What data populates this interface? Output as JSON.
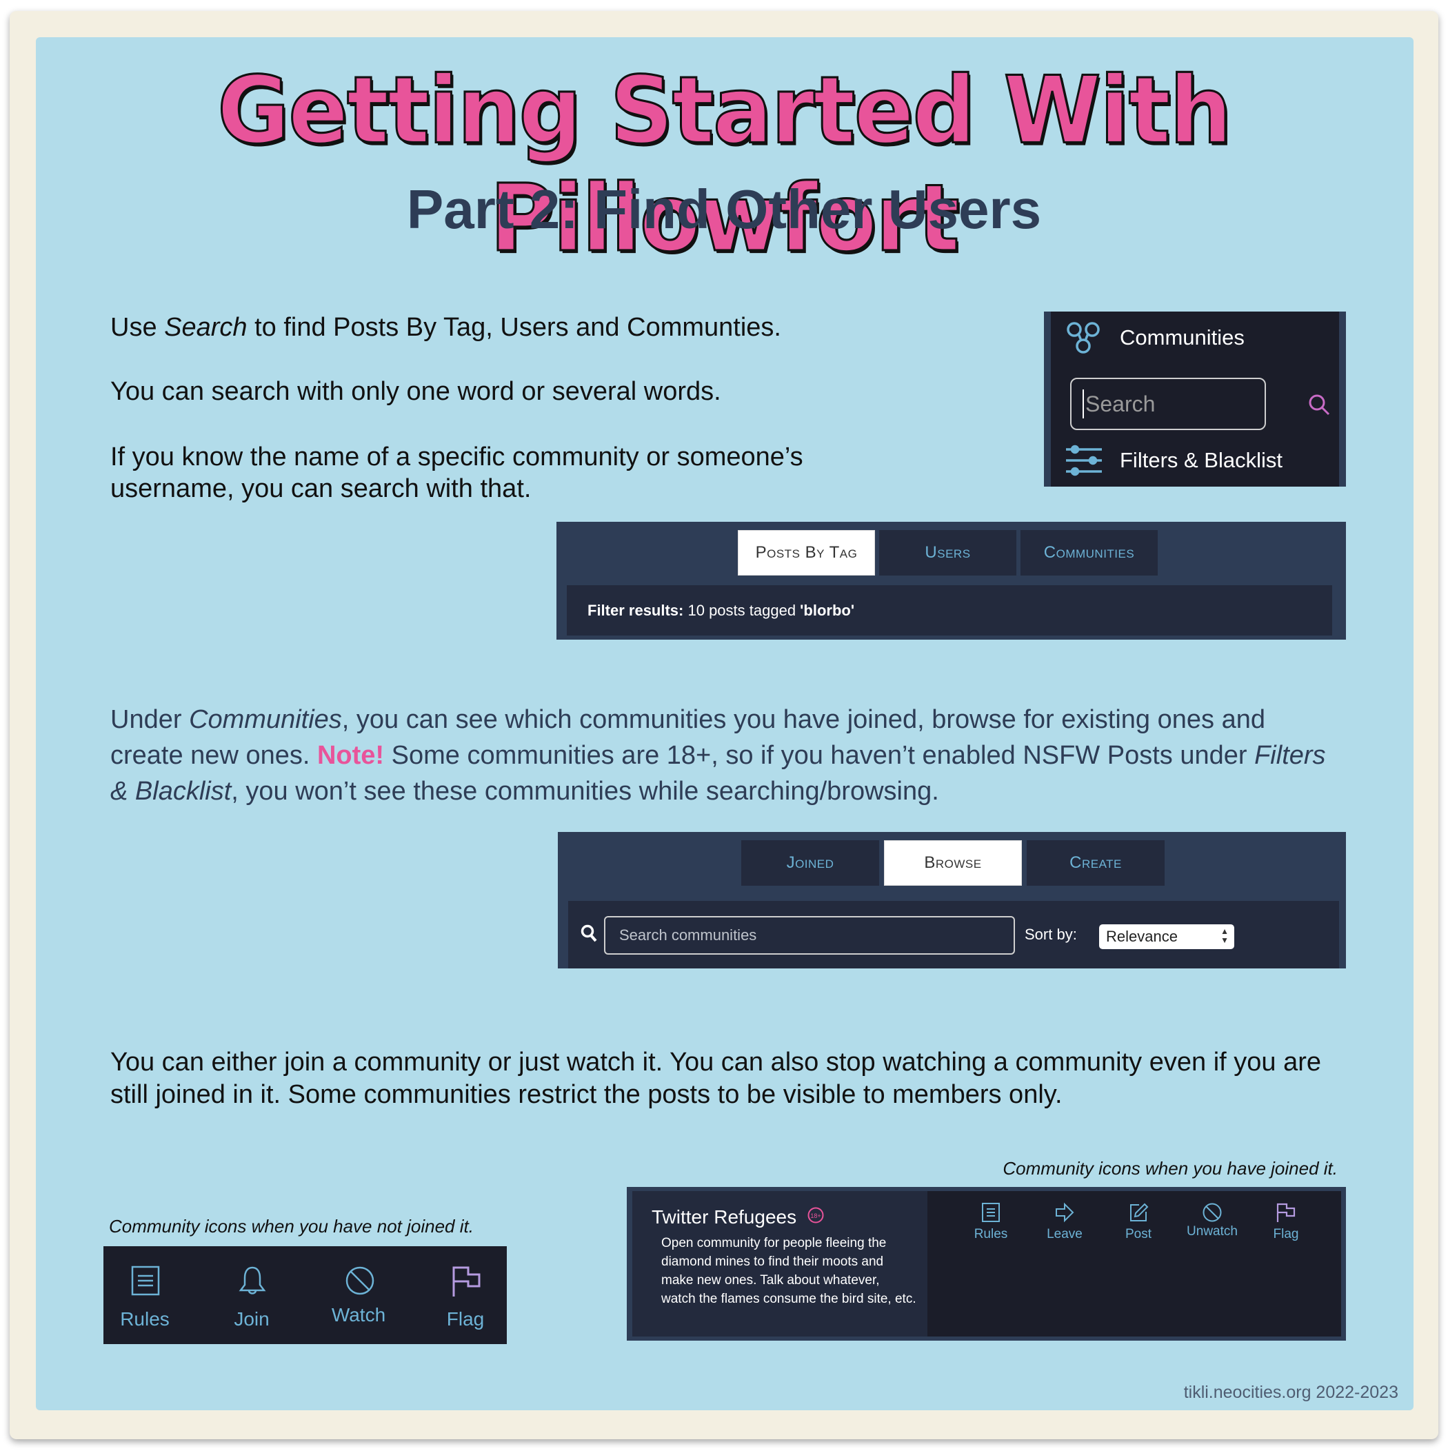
{
  "title": "Getting Started With Pillowfort",
  "subtitle": "Part 2: Find Other Users",
  "section1": {
    "line1_pre": "Use ",
    "line1_em": "Search",
    "line1_post": " to find Posts By Tag, Users and Communties.",
    "line2": "You can search with only one word or several words.",
    "line3": "If you know the name of a specific community or someone’s username, you can search with that."
  },
  "sidebar": {
    "communities_label": "Communities",
    "search_placeholder": "Search",
    "filters_label": "Filters & Blacklist"
  },
  "search_tabs": {
    "tabs": [
      {
        "label": "Posts By Tag",
        "active": true
      },
      {
        "label": "Users",
        "active": false
      },
      {
        "label": "Communities",
        "active": false
      }
    ],
    "filter_label": "Filter results:",
    "filter_count_text": " 10 posts tagged ",
    "filter_tag": "'blorbo'"
  },
  "section2": {
    "p1": "Under ",
    "p1_em": "Communities",
    "p2": ", you can see which communities you have joined, browse for existing ones and create new ones. ",
    "note": "Note!",
    "p3": " Some communities are 18+, so if you haven’t enabled NSFW Posts under ",
    "p3_em": "Filters & Blacklist",
    "p4": ", you won’t see these communities while searching/browsing."
  },
  "community_tabs": {
    "tabs": [
      {
        "label": "Joined",
        "active": false
      },
      {
        "label": "Browse",
        "active": true
      },
      {
        "label": "Create",
        "active": false
      }
    ],
    "search_placeholder": "Search communities",
    "sort_label": "Sort by:",
    "sort_value": "Relevance"
  },
  "section3": {
    "text": "You can either join a community or just watch it. You can also stop watching a community even if you are still joined in it. Some communities restrict the posts to be visible to members only."
  },
  "not_joined": {
    "caption": "Community icons when you have not joined it.",
    "items": [
      {
        "icon": "rules-icon",
        "label": "Rules"
      },
      {
        "icon": "bell-icon",
        "label": "Join"
      },
      {
        "icon": "block-icon",
        "label": "Watch"
      },
      {
        "icon": "flag-icon",
        "label": "Flag"
      }
    ]
  },
  "joined": {
    "caption": "Community icons when you have joined it.",
    "name": "Twitter Refugees",
    "badge": "18+",
    "description": "Open community for people fleeing the diamond mines to find their moots and make new ones. Talk about whatever, watch the flames consume the bird site, etc.",
    "items": [
      {
        "icon": "rules-icon",
        "label": "Rules"
      },
      {
        "icon": "leave-arrow-icon",
        "label": "Leave"
      },
      {
        "icon": "edit-post-icon",
        "label": "Post"
      },
      {
        "icon": "block-icon",
        "label": "Unwatch"
      },
      {
        "icon": "flag-icon",
        "label": "Flag"
      }
    ]
  },
  "colors": {
    "background_blue": "#b2dcea",
    "title_pink": "#e8549a",
    "navy": "#2e3d56",
    "dark_panel": "#1b1d29",
    "icon_blue": "#6db3d6",
    "flag_purple": "#b59be0"
  },
  "credit": "tikli.neocities.org 2022-2023"
}
